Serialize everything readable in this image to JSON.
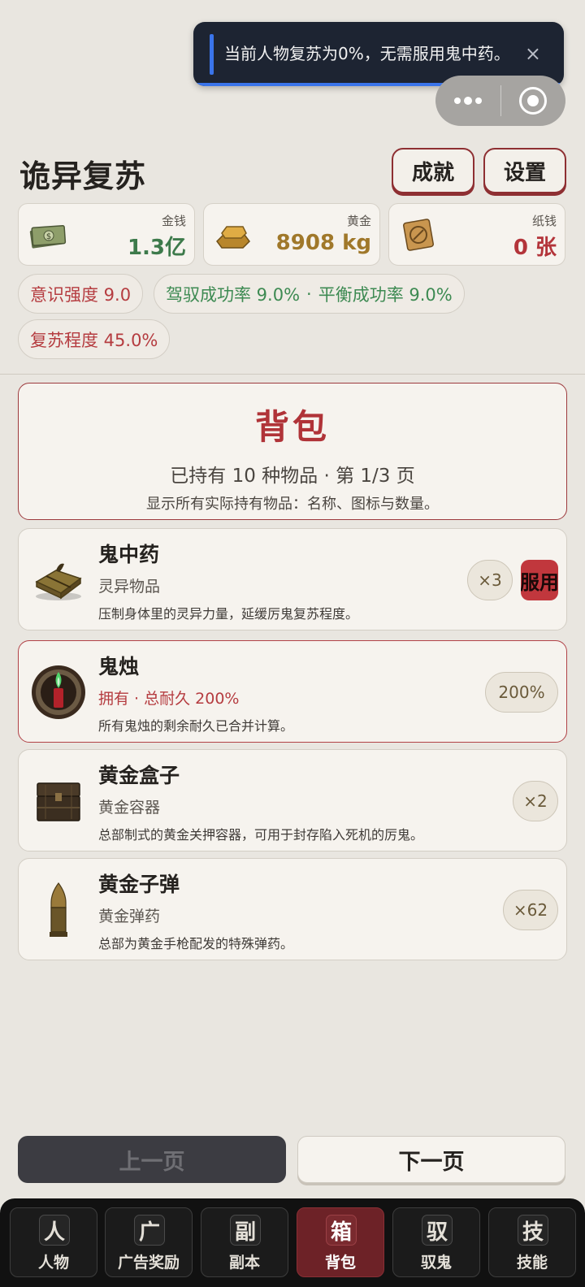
{
  "toast": {
    "message": "当前人物复苏为0%，无需服用鬼中药。",
    "close": "×"
  },
  "header": {
    "title": "诡异复苏",
    "achievements": "成就",
    "settings": "设置"
  },
  "currency": [
    {
      "label": "金钱",
      "value": "1.3亿",
      "icon": "cash-icon"
    },
    {
      "label": "黄金",
      "value": "8908 kg",
      "icon": "gold-bar-icon"
    },
    {
      "label": "纸钱",
      "value": "0 张",
      "icon": "paper-money-icon"
    }
  ],
  "stats": {
    "consciousness": "意识强度 9.0",
    "control_rate": "驾驭成功率 9.0%",
    "dot": "·",
    "balance_rate": "平衡成功率 9.0%",
    "revival": "复苏程度 45.0%"
  },
  "backpack": {
    "title": "背包",
    "count": "已持有 10 种物品 · 第 1/3 页",
    "desc": "显示所有实际持有物品：名称、图标与数量。"
  },
  "items": [
    {
      "name": "鬼中药",
      "sub": "灵异物品",
      "desc": "压制身体里的灵异力量，延缓厉鬼复苏程度。",
      "qty": "×3",
      "action": "服用",
      "icon": "herb-bundle-icon"
    },
    {
      "name": "鬼烛",
      "sub": "拥有 · 总耐久 200%",
      "desc": "所有鬼烛的剩余耐久已合并计算。",
      "qty": "200%",
      "icon": "candle-icon"
    },
    {
      "name": "黄金盒子",
      "sub": "黄金容器",
      "desc": "总部制式的黄金关押容器，可用于封存陷入死机的厉鬼。",
      "qty": "×2",
      "icon": "gold-box-icon"
    },
    {
      "name": "黄金子弹",
      "sub": "黄金弹药",
      "desc": "总部为黄金手枪配发的特殊弹药。",
      "qty": "×62",
      "icon": "bullet-icon"
    }
  ],
  "pager": {
    "prev": "上一页",
    "next": "下一页"
  },
  "tabs": [
    {
      "glyph": "人",
      "label": "人物"
    },
    {
      "glyph": "广",
      "label": "广告奖励"
    },
    {
      "glyph": "副",
      "label": "副本"
    },
    {
      "glyph": "箱",
      "label": "背包"
    },
    {
      "glyph": "驭",
      "label": "驭鬼"
    },
    {
      "glyph": "技",
      "label": "技能"
    }
  ],
  "colors": {
    "accent_red": "#b03338",
    "green": "#3d8a52",
    "gold": "#a0782a",
    "tab_active": "#6d2227"
  }
}
